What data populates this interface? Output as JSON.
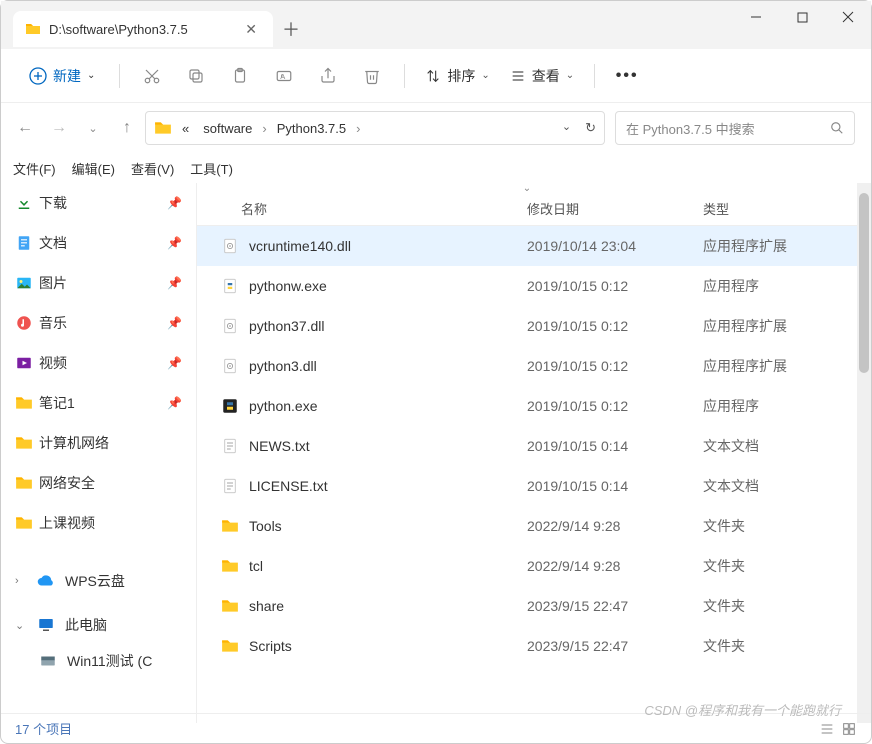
{
  "window": {
    "tab_title": "D:\\software\\Python3.7.5"
  },
  "toolbar": {
    "new_label": "新建",
    "sort_label": "排序",
    "view_label": "查看"
  },
  "breadcrumb": {
    "prefix": "«",
    "seg1": "software",
    "seg2": "Python3.7.5"
  },
  "search": {
    "placeholder": "在 Python3.7.5 中搜索"
  },
  "menu": {
    "file": "文件(F)",
    "edit": "编辑(E)",
    "view": "查看(V)",
    "tools": "工具(T)"
  },
  "sidebar": {
    "items": [
      {
        "label": "下载",
        "icon": "download",
        "pinned": true
      },
      {
        "label": "文档",
        "icon": "doc",
        "pinned": true
      },
      {
        "label": "图片",
        "icon": "pic",
        "pinned": true
      },
      {
        "label": "音乐",
        "icon": "music",
        "pinned": true
      },
      {
        "label": "视频",
        "icon": "video",
        "pinned": true
      },
      {
        "label": "笔记1",
        "icon": "folder",
        "pinned": true
      },
      {
        "label": "计算机网络",
        "icon": "folder",
        "pinned": false
      },
      {
        "label": "网络安全",
        "icon": "folder",
        "pinned": false
      },
      {
        "label": "上课视频",
        "icon": "folder",
        "pinned": false
      }
    ],
    "wps": "WPS云盘",
    "thispc": "此电脑",
    "win11": "Win11测试 (C"
  },
  "columns": {
    "name": "名称",
    "date": "修改日期",
    "type": "类型"
  },
  "files": [
    {
      "name": "vcruntime140.dll",
      "date": "2019/10/14 23:04",
      "type": "应用程序扩展",
      "icon": "dll",
      "sel": true
    },
    {
      "name": "pythonw.exe",
      "date": "2019/10/15 0:12",
      "type": "应用程序",
      "icon": "pyexe",
      "sel": false
    },
    {
      "name": "python37.dll",
      "date": "2019/10/15 0:12",
      "type": "应用程序扩展",
      "icon": "dll",
      "sel": false
    },
    {
      "name": "python3.dll",
      "date": "2019/10/15 0:12",
      "type": "应用程序扩展",
      "icon": "dll",
      "sel": false
    },
    {
      "name": "python.exe",
      "date": "2019/10/15 0:12",
      "type": "应用程序",
      "icon": "pyexe2",
      "sel": false
    },
    {
      "name": "NEWS.txt",
      "date": "2019/10/15 0:14",
      "type": "文本文档",
      "icon": "txt",
      "sel": false
    },
    {
      "name": "LICENSE.txt",
      "date": "2019/10/15 0:14",
      "type": "文本文档",
      "icon": "txt",
      "sel": false
    },
    {
      "name": "Tools",
      "date": "2022/9/14 9:28",
      "type": "文件夹",
      "icon": "folder",
      "sel": false
    },
    {
      "name": "tcl",
      "date": "2022/9/14 9:28",
      "type": "文件夹",
      "icon": "folder",
      "sel": false
    },
    {
      "name": "share",
      "date": "2023/9/15 22:47",
      "type": "文件夹",
      "icon": "folder",
      "sel": false
    },
    {
      "name": "Scripts",
      "date": "2023/9/15 22:47",
      "type": "文件夹",
      "icon": "folder",
      "sel": false
    }
  ],
  "status": {
    "count": "17 个项目"
  },
  "watermark": "CSDN @程序和我有一个能跑就行"
}
